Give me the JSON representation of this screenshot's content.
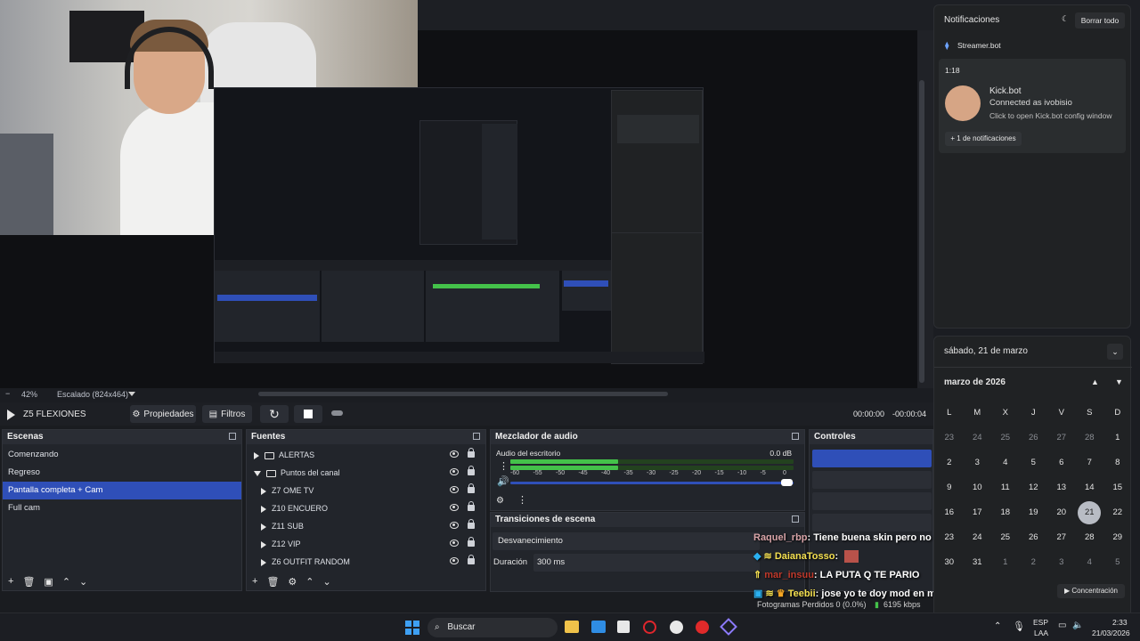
{
  "preview": {
    "zoom": "42%",
    "scale_mode": "Escalado (824x464)"
  },
  "transport": {
    "scene_name": "Z5 FLEXIONES",
    "properties_label": "Propiedades",
    "filters_label": "Filtros",
    "time_current": "00:00:00",
    "time_remaining": "-00:00:04"
  },
  "scenes": {
    "title": "Escenas",
    "items": [
      "Comenzando",
      "Regreso",
      "Pantalla completa + Cam",
      "Full cam"
    ],
    "selected_index": 2
  },
  "sources": {
    "title": "Fuentes",
    "items": [
      {
        "label": "ALERTAS",
        "kind": "folder",
        "state": "collapsed"
      },
      {
        "label": "Puntos del  canal",
        "kind": "folder",
        "state": "expanded"
      },
      {
        "label": "Z7 OME TV",
        "kind": "media"
      },
      {
        "label": "Z10 ENCUERO",
        "kind": "media"
      },
      {
        "label": "Z11 SUB",
        "kind": "media"
      },
      {
        "label": "Z12 VIP",
        "kind": "media"
      },
      {
        "label": "Z6 OUTFIT RANDOM",
        "kind": "media"
      }
    ]
  },
  "mixer": {
    "title": "Mezclador de audio",
    "channel": "Audio del escritorio",
    "db_value": "0.0 dB",
    "scale": [
      "-60",
      "-55",
      "-50",
      "-45",
      "-40",
      "-35",
      "-30",
      "-25",
      "-20",
      "-15",
      "-10",
      "-5",
      "0"
    ],
    "level": 0.38
  },
  "transitions": {
    "title": "Transiciones de escena",
    "selected": "Desvanecimiento",
    "duration_label": "Duración",
    "duration_value": "300 ms"
  },
  "controls": {
    "title": "Controles"
  },
  "chat": [
    {
      "user": "Raquel_rbp",
      "message": ": Tiene buena skin pero no tiene la voz de Mottol o Naza",
      "color": "#d9a4a8"
    },
    {
      "user": "DaianaTosso",
      "message": ":",
      "color": "#f5e050"
    },
    {
      "user": "mar_insuu",
      "message": ": LA PUTA Q TE PARIO",
      "color": "#c0392b"
    },
    {
      "user": "Teebii",
      "message": ": jose yo te doy mod en mi canal si queres",
      "color": "#f5e050"
    }
  ],
  "status": {
    "frames_lost": "Fotogramas Perdidos 0 (0.0%)",
    "bitrate": "6195 kbps",
    "concentration": "Concentración"
  },
  "notifications": {
    "title": "Notificaciones",
    "clear_all": "Borrar todo",
    "app": "Streamer.bot",
    "time": "1:18",
    "card_title": "Kick.bot",
    "card_line1": "Connected as ivobisio",
    "card_line2": "Click to open Kick.bot config window",
    "more": "+ 1 de notificaciones"
  },
  "calendar": {
    "date_header": "sábado, 21 de marzo",
    "month": "marzo de 2026",
    "weekdays": [
      "L",
      "M",
      "X",
      "J",
      "V",
      "S",
      "D"
    ],
    "days": [
      {
        "d": "23",
        "dim": true
      },
      {
        "d": "24",
        "dim": true
      },
      {
        "d": "25",
        "dim": true
      },
      {
        "d": "26",
        "dim": true
      },
      {
        "d": "27",
        "dim": true
      },
      {
        "d": "28",
        "dim": true
      },
      {
        "d": "1",
        "dim": false
      },
      {
        "d": "2",
        "dim": false
      },
      {
        "d": "3",
        "dim": false
      },
      {
        "d": "4",
        "dim": false
      },
      {
        "d": "5",
        "dim": false
      },
      {
        "d": "6",
        "dim": false
      },
      {
        "d": "7",
        "dim": false
      },
      {
        "d": "8",
        "dim": false
      },
      {
        "d": "9",
        "dim": false
      },
      {
        "d": "10",
        "dim": false
      },
      {
        "d": "11",
        "dim": false
      },
      {
        "d": "12",
        "dim": false
      },
      {
        "d": "13",
        "dim": false
      },
      {
        "d": "14",
        "dim": false
      },
      {
        "d": "15",
        "dim": false
      },
      {
        "d": "16",
        "dim": false
      },
      {
        "d": "17",
        "dim": false
      },
      {
        "d": "18",
        "dim": false
      },
      {
        "d": "19",
        "dim": false
      },
      {
        "d": "20",
        "dim": false
      },
      {
        "d": "21",
        "dim": false,
        "today": true
      },
      {
        "d": "22",
        "dim": false
      },
      {
        "d": "23",
        "dim": false
      },
      {
        "d": "24",
        "dim": false
      },
      {
        "d": "25",
        "dim": false
      },
      {
        "d": "26",
        "dim": false
      },
      {
        "d": "27",
        "dim": false
      },
      {
        "d": "28",
        "dim": false
      },
      {
        "d": "29",
        "dim": false
      },
      {
        "d": "30",
        "dim": false
      },
      {
        "d": "31",
        "dim": false
      },
      {
        "d": "1",
        "dim": true
      },
      {
        "d": "2",
        "dim": true
      },
      {
        "d": "3",
        "dim": true
      },
      {
        "d": "4",
        "dim": true
      },
      {
        "d": "5",
        "dim": true
      }
    ]
  },
  "taskbar": {
    "search": "Buscar",
    "lang": "ESP",
    "lang_sub": "LAA",
    "time": "2:33",
    "date": "21/03/2026"
  },
  "colors": {
    "accent": "#2f4fb8",
    "meter_green": "#44c24a",
    "meter_yellow": "#c7b23a",
    "meter_red": "#b33a3a"
  }
}
